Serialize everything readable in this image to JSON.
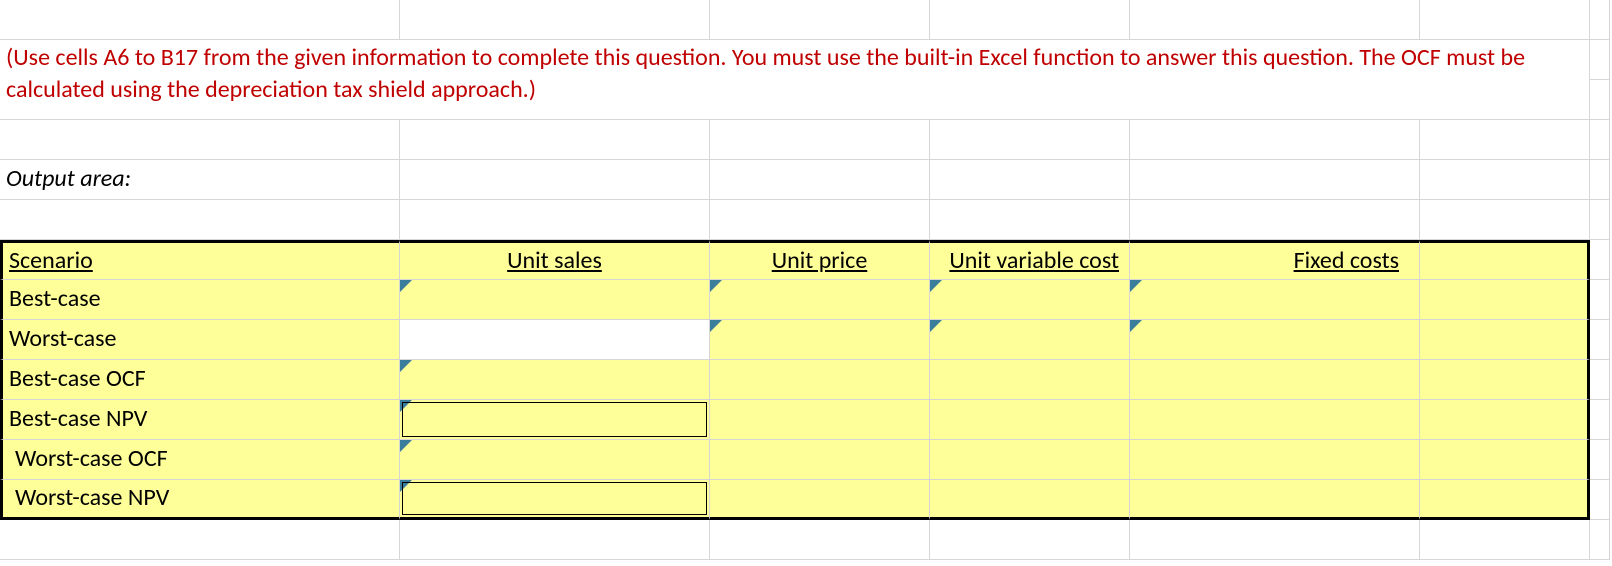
{
  "instruction": "(Use cells A6 to B17 from the given information to complete this question. You must use the built-in Excel function to answer this question. The OCF must be calculated using the depreciation tax shield approach.)",
  "output_label": "Output area:",
  "headers": {
    "scenario": "Scenario",
    "unit_sales": " Unit sales",
    "unit_price": "Unit price",
    "unit_var_cost": "Unit variable cost",
    "fixed_costs": "Fixed costs"
  },
  "row_labels": {
    "best": "Best-case",
    "worst": "Worst-case",
    "best_ocf": "Best-case OCF",
    "best_npv": "Best-case NPV",
    "worst_ocf": "Worst-case OCF",
    "worst_npv": "Worst-case NPV"
  }
}
